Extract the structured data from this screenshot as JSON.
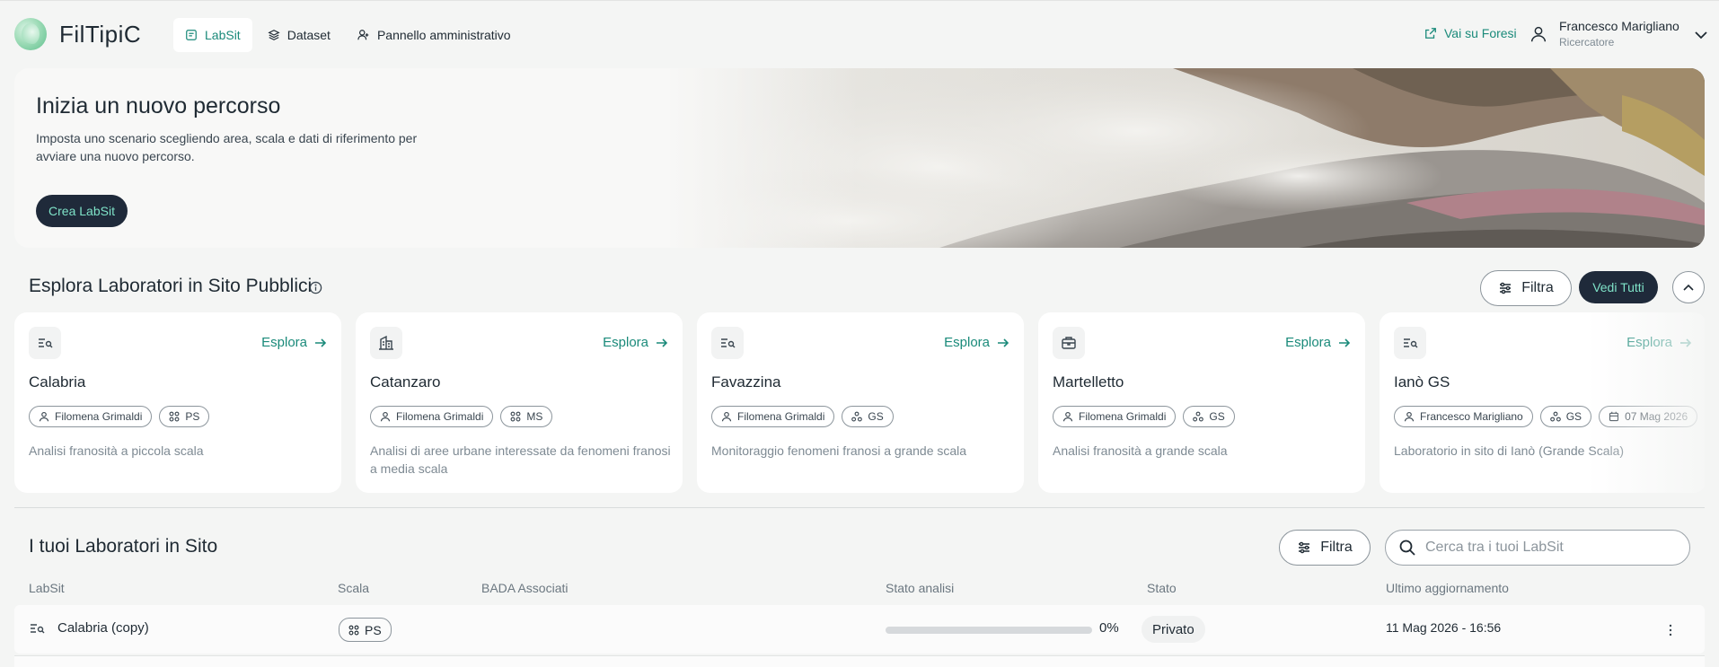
{
  "app": {
    "name": "FilTipiC"
  },
  "nav": [
    {
      "label": "LabSit",
      "icon": "labsit-icon",
      "active": true
    },
    {
      "label": "Dataset",
      "icon": "layers-icon",
      "active": false
    },
    {
      "label": "Pannello amministrativo",
      "icon": "user-admin-icon",
      "active": false
    }
  ],
  "header": {
    "external_link": "Vai su Foresi",
    "user_name": "Francesco Marigliano",
    "user_role": "Ricercatore"
  },
  "hero": {
    "title": "Inizia un nuovo percorso",
    "description": "Imposta uno scenario scegliendo area, scala e dati di riferimento per avviare una nuovo percorso.",
    "cta": "Crea LabSit"
  },
  "explore": {
    "title": "Esplora Laboratori in Sito Pubblici",
    "filter_label": "Filtra",
    "see_all_label": "Vedi Tutti",
    "cards": [
      {
        "icon": "search-list-icon",
        "explore": "Esplora",
        "title": "Calabria",
        "author": "Filomena Grimaldi",
        "scale": "PS",
        "scale_icon": "grid-icon",
        "date": "",
        "description": "Analisi franosità a piccola scala"
      },
      {
        "icon": "building-icon",
        "explore": "Esplora",
        "title": "Catanzaro",
        "author": "Filomena Grimaldi",
        "scale": "MS",
        "scale_icon": "grid-icon",
        "date": "",
        "description": "Analisi di aree urbane interessate da fenomeni franosi a media scala"
      },
      {
        "icon": "search-list-icon",
        "explore": "Esplora",
        "title": "Favazzina",
        "author": "Filomena Grimaldi",
        "scale": "GS",
        "scale_icon": "nodes-icon",
        "date": "",
        "description": "Monitoraggio fenomeni franosi a grande scala"
      },
      {
        "icon": "briefcase-icon",
        "explore": "Esplora",
        "title": "Martelletto",
        "author": "Filomena Grimaldi",
        "scale": "GS",
        "scale_icon": "nodes-icon",
        "date": "",
        "description": "Analisi franosità a grande scala"
      },
      {
        "icon": "search-list-icon",
        "explore": "Esplora",
        "title": "Ianò GS",
        "author": "Francesco Marigliano",
        "scale": "GS",
        "scale_icon": "nodes-icon",
        "date": "07 Mag 2026",
        "description": "Laboratorio in sito di Ianò (Grande Scala)"
      }
    ]
  },
  "mine": {
    "title": "I tuoi Laboratori in Sito",
    "filter_label": "Filtra",
    "search_placeholder": "Cerca tra i tuoi LabSit",
    "columns": {
      "labsit": "LabSit",
      "scala": "Scala",
      "bada": "BADA Associati",
      "stato_analisi": "Stato analisi",
      "stato": "Stato",
      "ultimo": "Ultimo aggiornamento"
    },
    "rows": [
      {
        "icon": "search-list-icon",
        "name": "Calabria (copy)",
        "scale": "PS",
        "bada": "",
        "progress": 0,
        "progress_label": "0%",
        "stato": "Privato",
        "updated": "11 Mag 2026 - 16:56"
      }
    ]
  },
  "colors": {
    "accent": "#1a8a7a",
    "dark": "#1f2a3a",
    "cta_text": "#7fe3c8"
  }
}
